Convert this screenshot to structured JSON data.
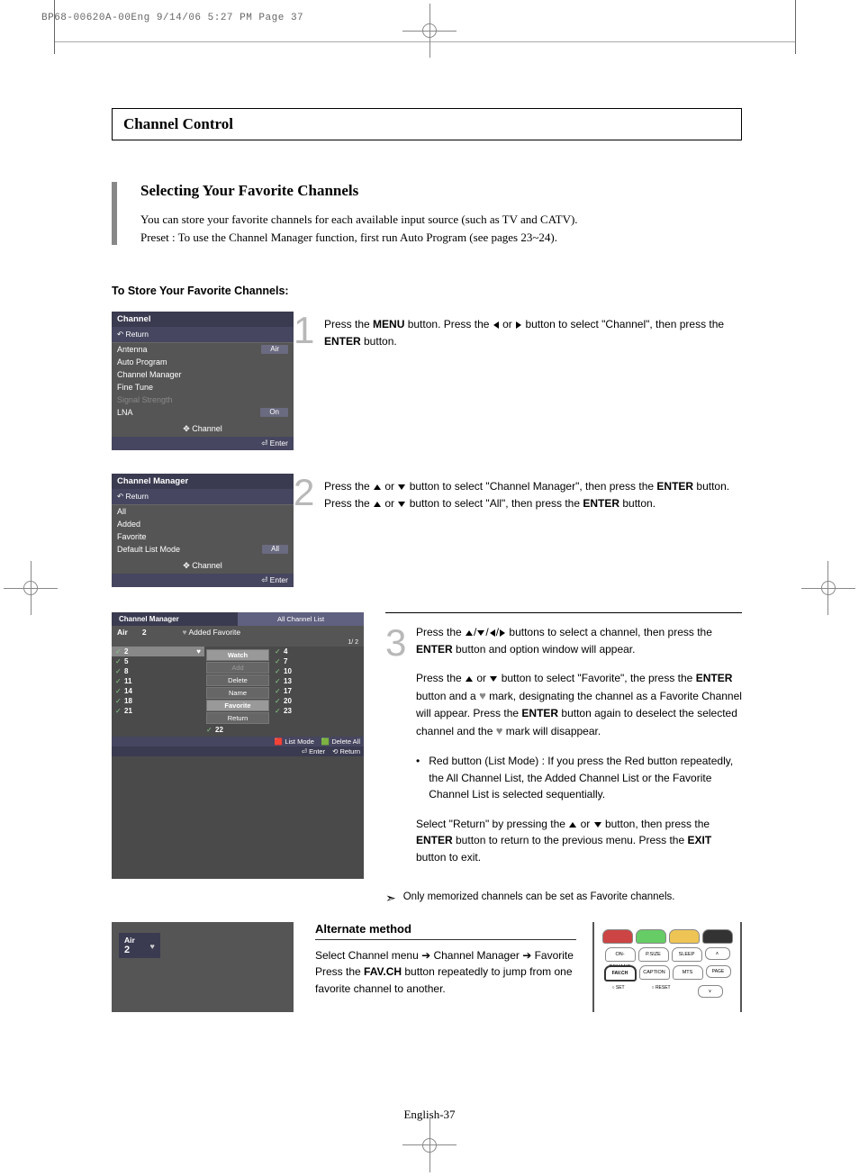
{
  "print_header": "BP68-00620A-00Eng  9/14/06  5:27 PM  Page 37",
  "title_box": "Channel Control",
  "section": {
    "title": "Selecting Your Favorite Channels",
    "p1": "You can store your favorite channels for each available input source (such as TV and CATV).",
    "p2": "Preset : To use the Channel Manager function, first run Auto Program (see pages 23~24)."
  },
  "sub_heading": "To Store Your Favorite Channels:",
  "osd1": {
    "title": "Channel",
    "return": "Return",
    "rows": {
      "antenna": "Antenna",
      "antenna_v": "Air",
      "auto": "Auto Program",
      "cm": "Channel Manager",
      "ft": "Fine Tune",
      "ss": "Signal Strength",
      "lna": "LNA",
      "lna_v": "On"
    },
    "foot_mid": "Channel",
    "foot_bot": "Enter"
  },
  "step1": {
    "a": "Press the ",
    "b": "MENU",
    "c": " button. Press the ",
    "d": " or ",
    "e": " button to select \"Channel\", then press the ",
    "f": "ENTER",
    "g": " button."
  },
  "osd2": {
    "title": "Channel Manager",
    "return": "Return",
    "rows": {
      "all": "All",
      "added": "Added",
      "fav": "Favorite",
      "dlm": "Default List Mode",
      "dlm_v": "All"
    },
    "foot_mid": "Channel",
    "foot_bot": "Enter"
  },
  "step2": {
    "a": "Press the ",
    "b": " or ",
    "c": " button to select \"Channel Manager\", then press the ",
    "d": "ENTER",
    "e": " button. Press the ",
    "f": " or ",
    "g": " button to select \"All\", then press the ",
    "h": "ENTER",
    "i": " button."
  },
  "osd3": {
    "t1": "Channel Manager",
    "t2": "All Channel List",
    "air": "Air",
    "n": "2",
    "af": "Added   Favorite",
    "pg": "1/ 2",
    "left": [
      "2",
      "5",
      "8",
      "11",
      "14",
      "18",
      "21"
    ],
    "right": [
      "4",
      "7",
      "10",
      "13",
      "17",
      "20",
      "23"
    ],
    "mid": [
      "Watch",
      "Add",
      "Delete",
      "Name",
      "Favorite",
      "Return"
    ],
    "r22": "22",
    "bot1a": "List Mode",
    "bot1b": "Delete All",
    "bot2a": "Enter",
    "bot2b": "Return"
  },
  "step3": {
    "p1a": "Press the ",
    "p1b": " buttons to select a channel, then press the ",
    "p1c": "ENTER",
    "p1d": " button and option window will appear.",
    "p2a": "Press the ",
    "p2b": " or ",
    "p2c": " button to select \"Favorite\", the press the ",
    "p2d": "ENTER",
    "p2e": " button and a ",
    "p2f": " mark, designating the channel as a Favorite Channel will appear. Press the ",
    "p2g": "ENTER",
    "p2h": " button again to deselect the selected channel and the ",
    "p2i": " mark will disappear.",
    "b1": "Red button (List Mode) : If you press the Red  button repeatedly, the All Channel List, the Added Channel List or the Favorite Channel List is selected sequentially.",
    "p3a": "Select \"Return\" by pressing the ",
    "p3b": " or ",
    "p3c": " button, then press the ",
    "p3d": "ENTER",
    "p3e": " button to return to the previous menu. Press the ",
    "p3f": "EXIT",
    "p3g": " button to exit."
  },
  "note": "Only memorized channels can be set as Favorite channels.",
  "alt": {
    "title": "Alternate method",
    "t1": "Select Channel menu ➔ Channel Manager ➔ Favorite",
    "t2a": "Press the ",
    "t2b": "FAV.CH",
    "t2c": " button repeatedly to jump from one favorite channel to another."
  },
  "alt_osd": {
    "a": "Air",
    "b": "2"
  },
  "remote": {
    "r1": [
      "ON-DEMAND",
      "P.SIZE",
      "SLEEP"
    ],
    "r2": [
      "FAV.CH",
      "CAPTION",
      "MTS",
      "PAGE"
    ],
    "r3": [
      "SET",
      "RESET"
    ]
  },
  "footer": "English-37"
}
